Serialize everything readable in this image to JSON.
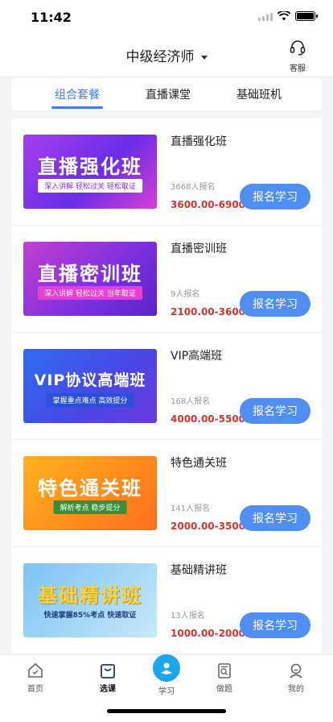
{
  "status_bar": {
    "time": "11:42"
  },
  "header": {
    "title": "中级经济师",
    "service_label": "客服"
  },
  "tabs": [
    {
      "label": "组合套餐",
      "active": true
    },
    {
      "label": "直播课堂",
      "active": false
    },
    {
      "label": "基础班机",
      "active": false
    }
  ],
  "courses": [
    {
      "name": "直播强化班",
      "banner_title": "直播强化班",
      "banner_subtitle": "深入讲解 轻松过关 轻松取证",
      "enrolled": "3668人报名",
      "price": "3600.00-6900.00",
      "button": "报名学习"
    },
    {
      "name": "直播密训班",
      "banner_title": "直播密训班",
      "banner_subtitle": "深入讲解 轻松过关 当年取证",
      "enrolled": "9人报名",
      "price": "2100.00-3600.00",
      "button": "报名学习"
    },
    {
      "name": "VIP高端班",
      "banner_title": "VIP协议高端班",
      "banner_subtitle": "掌握重点难点 高效提分",
      "enrolled": "168人报名",
      "price": "4000.00-5500.00",
      "button": "报名学习"
    },
    {
      "name": "特色通关班",
      "banner_title": "特色通关班",
      "banner_subtitle": "解析考点 稳步提分",
      "enrolled": "141人报名",
      "price": "2000.00-3500.00",
      "button": "报名学习"
    },
    {
      "name": "基础精讲班",
      "banner_title": "基础精讲班",
      "banner_subtitle": "快速掌握85%考点 快速取证",
      "enrolled": "13人报名",
      "price": "1000.00-2000.00",
      "button": "报名学习"
    }
  ],
  "tabbar": [
    {
      "label": "首页",
      "icon": "home-icon"
    },
    {
      "label": "选课",
      "icon": "shopping-bag-icon",
      "active": true
    },
    {
      "label": "学习",
      "icon": "study-icon"
    },
    {
      "label": "做题",
      "icon": "exercise-icon"
    },
    {
      "label": "我的",
      "icon": "profile-icon"
    }
  ],
  "colors": {
    "accent": "#3d7ef0",
    "price": "#d9342b",
    "button": "#4f8ff4",
    "study": "#1ba5ec"
  }
}
